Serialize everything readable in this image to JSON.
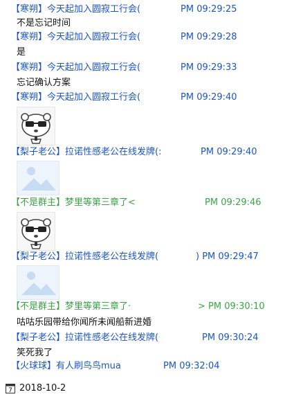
{
  "messages": [
    {
      "sender": "【寒朔】今天起加入圆寂工行会(",
      "time": "PM 09:29:25",
      "text": "不是忘记时间"
    },
    {
      "sender": "【寒朔】今天起加入圆寂工行会(",
      "time": "PM 09:29:28",
      "text": "是"
    },
    {
      "sender": "【寒朔】今天起加入圆寂工行会(",
      "time": "PM 09:29:33",
      "text": "忘记确认方案"
    },
    {
      "sender": "【寒朔】今天起加入圆寂工行会(",
      "time": "PM 09:29:40",
      "sticker": "cat-sticker"
    },
    {
      "sender": "【梨子老公】拉诺性感老公在线发牌(:",
      "time": "PM 09:29:40",
      "image": "image-placeholder"
    },
    {
      "sender": "【不是群主】梦里等第三章了<",
      "time": "PM 09:29:46",
      "sticker": "cat-sticker"
    },
    {
      "sender": "【梨子老公】拉诺性感老公在线发牌(",
      "time": ") PM 09:29:47",
      "image": "image-placeholder"
    },
    {
      "sender": "【不是群主】梦里等第三章了·",
      "time": "> PM 09:30:10",
      "text": "咕咕乐园带给你闻所未闻船新进婚"
    },
    {
      "sender": "【梨子老公】拉诺性感老公在线发牌(",
      "time": "PM 09:30:24",
      "text": "笑死我了"
    },
    {
      "sender": "【火球球】有人刷鸟鸟mua",
      "time": "PM 09:32:04"
    }
  ],
  "date_footer": {
    "date": "2018-10-2",
    "calendar_day": "7",
    "icon": "calendar-icon"
  },
  "colors": {
    "blue_sender": "#1a55c9",
    "green_sender": "#3aa545"
  }
}
